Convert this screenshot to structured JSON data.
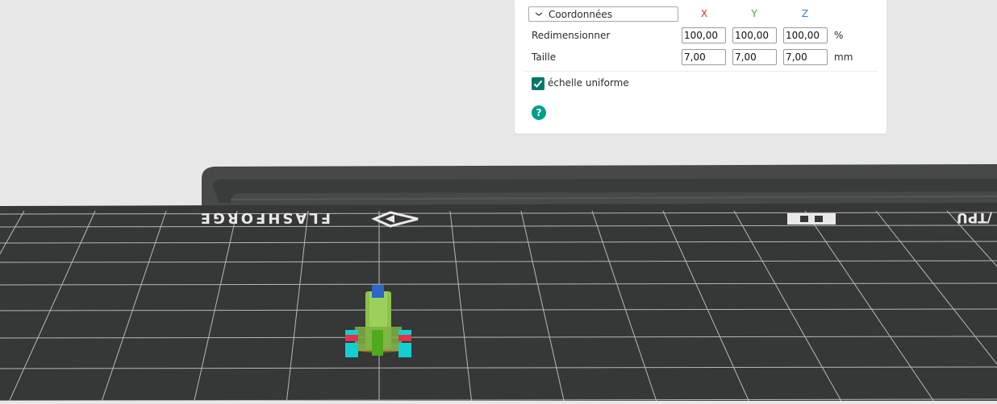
{
  "scale_panel": {
    "section_dropdown": "Coordonnées",
    "axes": {
      "x": "X",
      "y": "Y",
      "z": "Z"
    },
    "rows": [
      {
        "label": "Redimensionner",
        "x": "100,00",
        "y": "100,00",
        "z": "100,00",
        "unit": "%"
      },
      {
        "label": "Taille",
        "x": "7,00",
        "y": "7,00",
        "z": "7,00",
        "unit": "mm"
      }
    ],
    "uniform_scale": {
      "label": "échelle uniforme",
      "checked": true
    },
    "help_button": "?"
  },
  "build_plate": {
    "brand_text": "FLASHFORGE",
    "material_text": "/TPU"
  },
  "colors": {
    "accent": "#00796b",
    "help": "#00a08a",
    "axis_x": "#e0312e",
    "axis_y": "#3aa94a",
    "axis_z": "#2f7fd6",
    "bed": "#3a3b3b",
    "model_body": "#8cc24a",
    "model_marker_cyan": "#11cfd3",
    "model_marker_red": "#e2334b",
    "model_top_blue": "#2c66c8"
  }
}
